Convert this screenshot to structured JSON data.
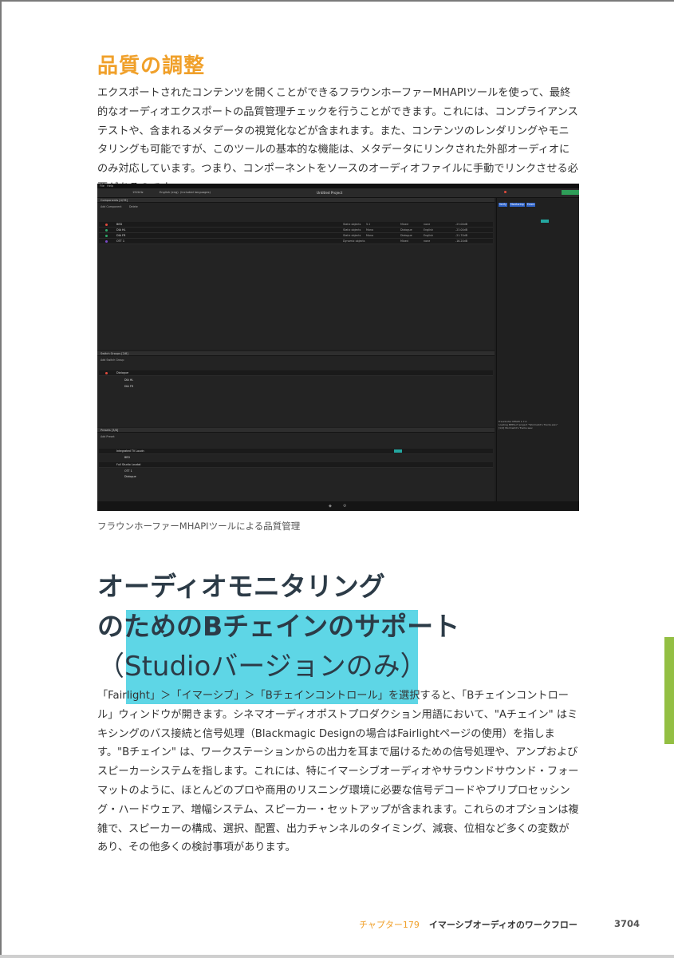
{
  "section_title": "品質の調整",
  "para1": "エクスポートされたコンテンツを開くことができるフラウンホーファーMHAPIツールを使って、最終的なオーディオエクスポートの品質管理チェックを行うことができます。これには、コンプライアンステストや、含まれるメタデータの視覚化などが含まれます。また、コンテンツのレンダリングやモニタリングも可能ですが、このツールの基本的な機能は、メタデータにリンクされた外部オーディオにのみ対応しています。つまり、コンポーネントをソースのオーディオファイルに手動でリンクさせる必要があるのです。",
  "screenshot": {
    "menu": [
      "File",
      "Help"
    ],
    "project_title": "Untitled Project",
    "sample_rate": "192kHz",
    "language": "English (eng)",
    "included_languages": "(included languages)",
    "right_buttons": [
      "Verify",
      "Monitoring",
      "Errors"
    ],
    "components_header": "Components [4/76]",
    "add_component": "Add Component",
    "delete": "Delete",
    "components": [
      {
        "label": "BED",
        "type": "Static objects",
        "layout": "5.1",
        "content": "Mixed",
        "lang": "none",
        "lufs": "-23.00dB",
        "dot": "#e14b3c"
      },
      {
        "label": "DIA HL",
        "type": "Static objects",
        "layout": "Mono",
        "content": "Dialogue",
        "lang": "English",
        "lufs": "-23.00dB",
        "dot": "#2ea86a"
      },
      {
        "label": "DIA FR",
        "type": "Static objects",
        "layout": "Mono",
        "content": "Dialogue",
        "lang": "English",
        "lufs": "-21.70dB",
        "dot": "#2ea86a"
      },
      {
        "label": "OTT 1",
        "type": "Dynamic objects",
        "layout": "",
        "content": "Mixed",
        "lang": "none",
        "lufs": "-16.20dB",
        "dot": "#7a4ac8"
      }
    ],
    "switch_header": "Switch Groups [2/8]",
    "add_switch": "Add Switch Group",
    "switch_group": "Dialogue",
    "switch_items": [
      "DIA HL",
      "DIA FR"
    ],
    "presets_header": "Presets [3/8]",
    "add_preset": "Add Preset",
    "presets": [
      "Integrated TV Loudn",
      "Full Studio Loudat"
    ],
    "preset_items": [
      "BED",
      "OTT 1",
      "Dialogue"
    ],
    "log_lines": [
      "Fraunhofer MHAPI 1.7.0",
      "Loading MPEG-H project \"Wormwild's Tracks.wav\"",
      "[1/4] Wormwild's Tracks.wav"
    ]
  },
  "caption": "フラウンホーファーMHAPIツールによる品質管理",
  "big_title_line1": "オーディオモニタリング",
  "big_title_line2": "のためのBチェインのサポート",
  "big_title_line3": "（Studioバージョンのみ）",
  "para2": "「Fairlight」＞「イマーシブ」＞「Bチェインコントロール」を選択すると、「Bチェインコントロール」ウィンドウが開きます。シネマオーディオポストプロダクション用語において、\"Aチェイン\" はミキシングのバス接続と信号処理（Blackmagic Designの場合はFairlightページの使用）を指します。\"Bチェイン\" は、ワークステーションからの出力を耳まで届けるための信号処理や、アンプおよびスピーカーシステムを指します。これには、特にイマーシブオーディオやサラウンドサウンド・フォーマットのように、ほとんどのプロや商用のリスニング環境に必要な信号デコードやプリプロセッシング・ハードウェア、増幅システム、スピーカー・セットアップが含まれます。これらのオプションは複雑で、スピーカーの構成、選択、配置、出力チャンネルのタイミング、減衰、位相など多くの変数があり、その他多くの検討事項があります。",
  "footer": {
    "chapter": "チャプター179",
    "title": "イマーシブオーディオのワークフロー",
    "page": "3704"
  },
  "colors": {
    "accent": "#f0a02a",
    "title": "#2c3b47",
    "highlight": "#5ed6e6",
    "tab": "#93bf43"
  }
}
